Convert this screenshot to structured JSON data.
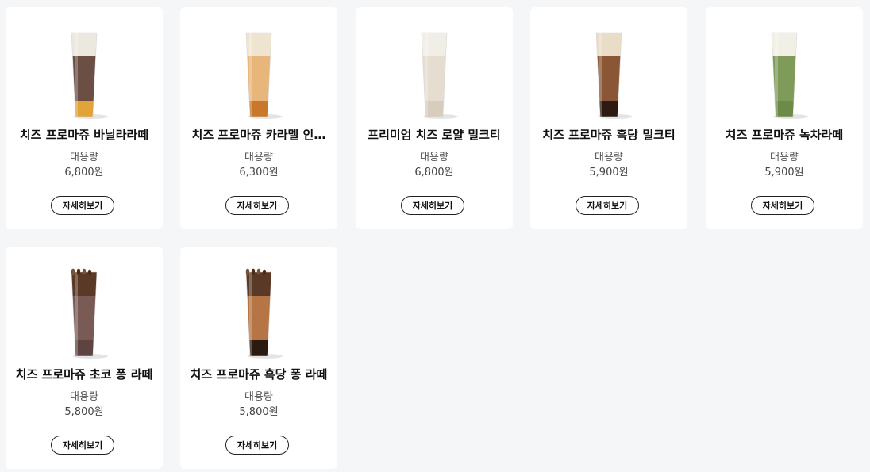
{
  "products": [
    {
      "name": "치즈 프로마쥬 바닐라라떼",
      "size": "대용량",
      "price": "6,800원",
      "button": "자세히보기",
      "colors": {
        "top": "#ede8df",
        "body": "#6b4f45",
        "bottom": "#e3a33b"
      }
    },
    {
      "name": "치즈 프로마쥬 카라멜 인…",
      "size": "대용량",
      "price": "6,300원",
      "button": "자세히보기",
      "colors": {
        "top": "#efe4d0",
        "body": "#e8b67a",
        "bottom": "#c9772a"
      }
    },
    {
      "name": "프리미엄 치즈 로얄 밀크티",
      "size": "대용량",
      "price": "6,800원",
      "button": "자세히보기",
      "colors": {
        "top": "#f1eee8",
        "body": "#e4ddd0",
        "bottom": "#d6cdbd"
      }
    },
    {
      "name": "치즈 프로마쥬 흑당 밀크티",
      "size": "대용량",
      "price": "5,900원",
      "button": "자세히보기",
      "colors": {
        "top": "#e9ddc8",
        "body": "#8a5636",
        "bottom": "#2d1a12"
      }
    },
    {
      "name": "치즈 프로마쥬 녹차라떼",
      "size": "대용량",
      "price": "5,900원",
      "button": "자세히보기",
      "colors": {
        "top": "#f1efe6",
        "body": "#7f9b5a",
        "bottom": "#6c8a48"
      }
    },
    {
      "name": "치즈 프로마쥬 초코 퐁 라떼",
      "size": "대용량",
      "price": "5,800원",
      "button": "자세히보기",
      "colors": {
        "top": "#5a3a26",
        "body": "#7a5a55",
        "bottom": "#5d4440"
      }
    },
    {
      "name": "치즈 프로마쥬 흑당 퐁 라떼",
      "size": "대용량",
      "price": "5,800원",
      "button": "자세히보기",
      "colors": {
        "top": "#5a3a26",
        "body": "#b57545",
        "bottom": "#2b1a10"
      }
    }
  ]
}
